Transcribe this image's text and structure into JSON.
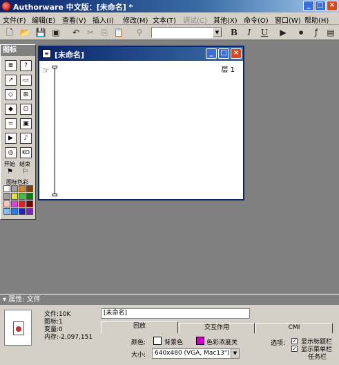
{
  "window": {
    "title": "Authorware 中文版：[未命名] *",
    "controls": {
      "minimize": "_",
      "maximize": "□",
      "close": "×"
    }
  },
  "menubar": [
    {
      "label": "文件(F)"
    },
    {
      "label": "编辑(E)"
    },
    {
      "label": "查看(V)"
    },
    {
      "label": "插入(I)"
    },
    {
      "label": "修改(M)"
    },
    {
      "label": "文本(T)"
    },
    {
      "label": "调试(C)",
      "disabled": true
    },
    {
      "label": "其他(X)"
    },
    {
      "label": "命令(O)"
    },
    {
      "label": "窗口(W)"
    },
    {
      "label": "帮助(H)"
    }
  ],
  "toolbar": {
    "bold": "B",
    "italic": "I",
    "underline": "U",
    "font_value": ""
  },
  "palette": {
    "title": "图标",
    "start_label": "开始",
    "end_label": "结束",
    "color_label": "图标色彩",
    "icons": [
      {
        "name": "display-icon",
        "glyph": "≣"
      },
      {
        "name": "wait-icon",
        "glyph": "?"
      },
      {
        "name": "motion-icon",
        "glyph": "↗"
      },
      {
        "name": "erase-icon",
        "glyph": "▭"
      },
      {
        "name": "navigate-icon",
        "glyph": "◇"
      },
      {
        "name": "framework-icon",
        "glyph": "⊞"
      },
      {
        "name": "decision-icon",
        "glyph": "◆"
      },
      {
        "name": "interaction-icon",
        "glyph": "⊡"
      },
      {
        "name": "calculation-icon",
        "glyph": "="
      },
      {
        "name": "map-icon",
        "glyph": "▣"
      },
      {
        "name": "digital-movie-icon",
        "glyph": "▶"
      },
      {
        "name": "sound-icon",
        "glyph": "♪"
      },
      {
        "name": "dvd-icon",
        "glyph": "◎"
      },
      {
        "name": "knowledge-object-icon",
        "glyph": "KO"
      }
    ],
    "colors": [
      "#ffffff",
      "#a0a0a0",
      "#e08020",
      "#804000",
      "#a0a0a0",
      "#e0e040",
      "#40c040",
      "#008000",
      "#ffc0c0",
      "#e040e0",
      "#e02020",
      "#800000",
      "#80c0ff",
      "#2080ff",
      "#2020c0",
      "#8020c0"
    ]
  },
  "document": {
    "title": "[未命名]",
    "layer_label": "层 1"
  },
  "properties": {
    "panel_title": "属性: 文件",
    "file_size": "文件:10K",
    "icon_count": "图标:1",
    "variable_count": "变量:0",
    "memory": "内存:-2,097,151",
    "name_value": "[未命名]",
    "tabs": [
      {
        "label": "回放",
        "active": true
      },
      {
        "label": "交互作用",
        "active": false
      },
      {
        "label": "CMI",
        "active": false
      }
    ],
    "color_label": "颜色:",
    "background_color_label": "背景色",
    "chroma_key_label": "色彩浓度关",
    "size_label": "大小:",
    "size_value": "640x480 (VGA, Mac13\")",
    "options_label": "选项:",
    "show_title_bar": "显示标题栏",
    "show_menu_bar": "显示菜单栏",
    "show_taskbar": "任务栏",
    "colors": {
      "background": "#ffffff",
      "chroma": "#cc00cc"
    }
  }
}
